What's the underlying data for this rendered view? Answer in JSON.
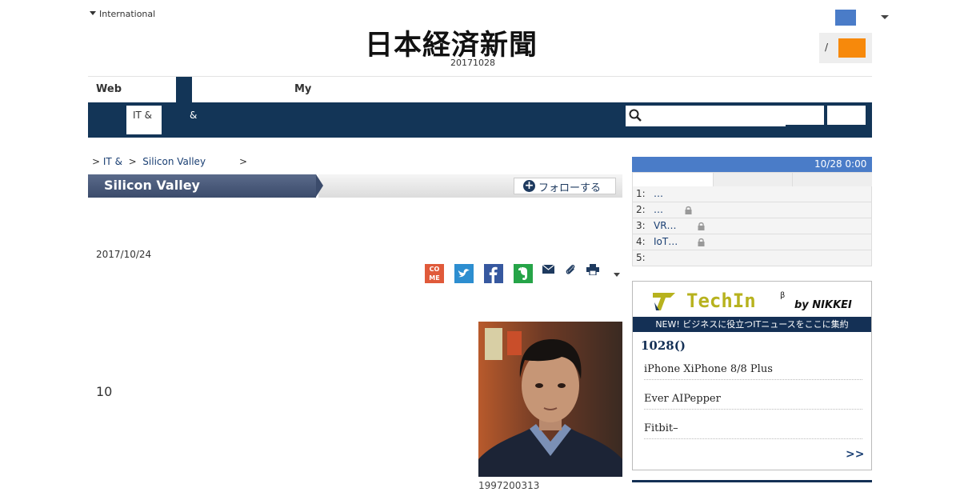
{
  "header": {
    "region_menu": "International",
    "logo_text": "日本経済新聞",
    "date": "20171028",
    "login_separator": "/"
  },
  "nav": {
    "tabs": [
      "Web",
      "My"
    ],
    "sub_items": [
      "IT &",
      "&"
    ]
  },
  "breadcrumb": {
    "items": [
      "IT &",
      "Silicon Valley"
    ],
    "separator": ">"
  },
  "topic": {
    "title": "Silicon Valley",
    "follow_label": "フォローする"
  },
  "article": {
    "date": "2017/10/24",
    "body_number": "10",
    "photo_caption": "1997200313",
    "share": [
      "come-icon",
      "twitter-icon",
      "facebook-icon",
      "evernote-icon",
      "mail-icon",
      "clip-icon",
      "print-icon"
    ],
    "come_label": "CO ME"
  },
  "ranking": {
    "time": "10/28 0:00",
    "rows": [
      {
        "num": "1:",
        "title": "…",
        "locked": false
      },
      {
        "num": "2:",
        "title": "…",
        "locked": true
      },
      {
        "num": "3:",
        "title": "VR…",
        "locked": true
      },
      {
        "num": "4:",
        "title": "IoT…",
        "locked": true
      },
      {
        "num": "5:",
        "title": "",
        "locked": false
      }
    ]
  },
  "promo": {
    "logo_text": "TechIn",
    "logo_sup": "β",
    "logo_by": "by NIKKEI",
    "banner": "NEW! ビジネスに役立つITニュースをここに集約",
    "date_heading": "1028()",
    "items": [
      "iPhone XiPhone 8/8 Plus",
      "Ever AIPepper",
      "Fitbit–"
    ],
    "more": ">>"
  },
  "colors": {
    "navy": "#133557",
    "accent_blue": "#4a7cc8",
    "orange": "#f7890b"
  }
}
